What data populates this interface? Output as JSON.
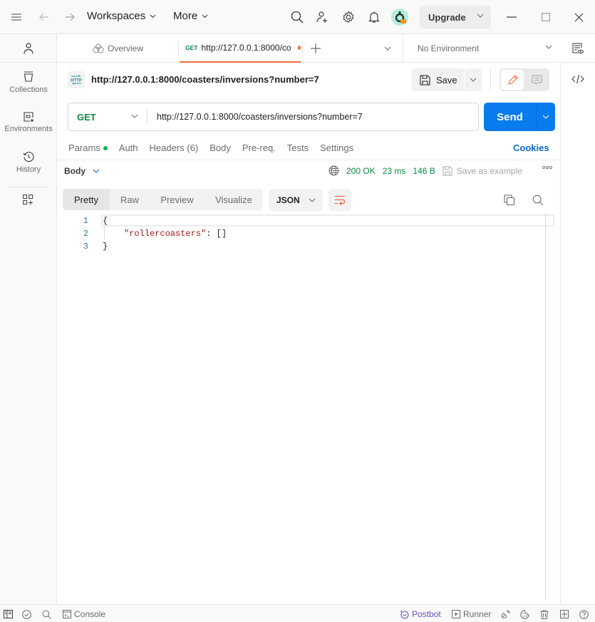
{
  "topbar": {
    "workspaces_label": "Workspaces",
    "more_label": "More",
    "upgrade_label": "Upgrade"
  },
  "sidebar": {
    "items": [
      {
        "label": "Collections",
        "icon": "collections-icon"
      },
      {
        "label": "Environments",
        "icon": "environments-icon"
      },
      {
        "label": "History",
        "icon": "history-icon"
      }
    ]
  },
  "tabs": {
    "overview_label": "Overview",
    "active_tab": {
      "method": "GET",
      "title": "http://127.0.0.1:8000/co",
      "unsaved": true
    },
    "environment_label": "No Environment"
  },
  "request": {
    "title": "http://127.0.0.1:8000/coasters/inversions?number=7",
    "method": "GET",
    "url": "http://127.0.0.1:8000/coasters/inversions?number=7",
    "save_label": "Save",
    "send_label": "Send",
    "subtabs": [
      {
        "label": "Params",
        "has_dot": true
      },
      {
        "label": "Auth"
      },
      {
        "label": "Headers (6)"
      },
      {
        "label": "Body"
      },
      {
        "label": "Pre-req."
      },
      {
        "label": "Tests"
      },
      {
        "label": "Settings"
      }
    ],
    "cookies_label": "Cookies"
  },
  "response": {
    "body_label": "Body",
    "status": "200 OK",
    "time": "23 ms",
    "size": "146 B",
    "save_example_label": "Save as example",
    "views": [
      "Pretty",
      "Raw",
      "Preview",
      "Visualize"
    ],
    "active_view": "Pretty",
    "format": "JSON",
    "lines": [
      {
        "n": "1",
        "text": "{"
      },
      {
        "n": "2",
        "key": "\"rollercoasters\"",
        "rest": ": []"
      },
      {
        "n": "3",
        "text": "}"
      }
    ]
  },
  "statusbar": {
    "console_label": "Console",
    "postbot_label": "Postbot",
    "runner_label": "Runner"
  },
  "colors": {
    "accent_orange": "#f26b3a",
    "send_blue": "#097bed",
    "method_green": "#0b8a3e",
    "postbot_purple": "#6b4fbb"
  }
}
